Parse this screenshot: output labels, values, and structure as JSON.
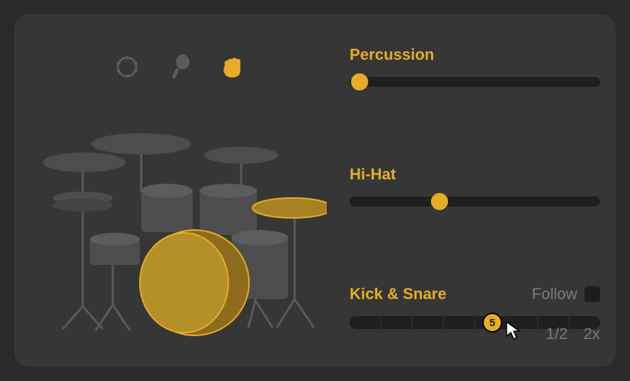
{
  "percussionIcons": {
    "tambourine": {
      "selected": false,
      "name": "tambourine"
    },
    "maraca": {
      "selected": false,
      "name": "maraca"
    },
    "clap": {
      "selected": true,
      "name": "clap"
    }
  },
  "controls": {
    "percussion": {
      "label": "Percussion",
      "value": 4,
      "min": 0,
      "max": 100
    },
    "hihat": {
      "label": "Hi-Hat",
      "value": 36,
      "min": 0,
      "max": 100
    },
    "kickSnare": {
      "label": "Kick & Snare",
      "follow": {
        "label": "Follow",
        "checked": false
      },
      "segments": 8,
      "value": 5,
      "tempo": {
        "half": "1/2",
        "double": "2x"
      }
    }
  },
  "drumKit": {
    "selectedPieces": [
      "kick",
      "ride"
    ],
    "pieces": [
      "crash-left",
      "crash-right",
      "hihat",
      "tom-high",
      "tom-mid",
      "tom-floor",
      "snare",
      "kick",
      "ride"
    ]
  },
  "colors": {
    "accent": "#e7ad26",
    "panel": "#363636",
    "track": "#1f1f1f",
    "muted": "#7b7b7b"
  }
}
